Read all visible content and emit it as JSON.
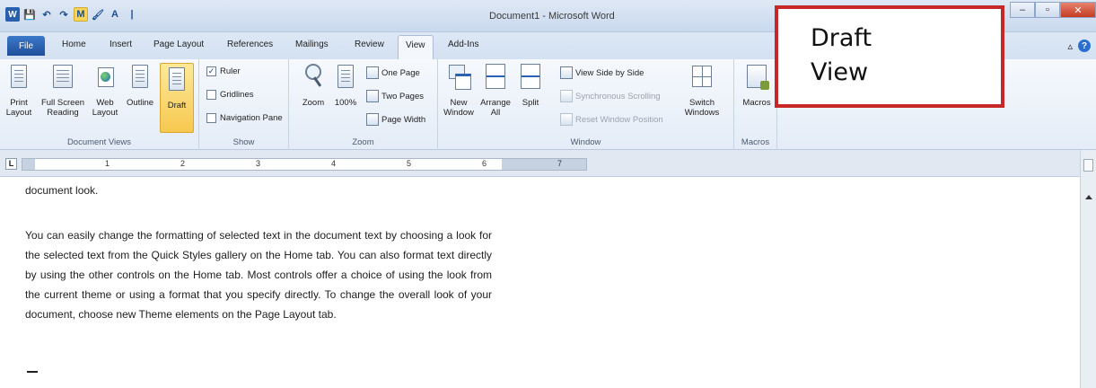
{
  "window": {
    "title": "Document1 - Microsoft Word",
    "controls": {
      "minimize": "–",
      "restore": "▫",
      "close": "✕"
    }
  },
  "quick_access": {
    "word_icon": "W",
    "save_icon": "💾",
    "undo_icon": "↶",
    "redo_icon": "↷",
    "highlight_icon": "M",
    "brush_icon": "🖌",
    "font_color_icon": "A",
    "more_icon": "|"
  },
  "tabs": [
    {
      "label": "File"
    },
    {
      "label": "Home"
    },
    {
      "label": "Insert"
    },
    {
      "label": "Page Layout"
    },
    {
      "label": "References"
    },
    {
      "label": "Mailings"
    },
    {
      "label": "Review"
    },
    {
      "label": "View"
    },
    {
      "label": "Add-Ins"
    }
  ],
  "active_tab": "View",
  "ribbon": {
    "document_views": {
      "label": "Document Views",
      "buttons": [
        "Print Layout",
        "Full Screen Reading",
        "Web Layout",
        "Outline",
        "Draft"
      ],
      "selected": "Draft"
    },
    "show": {
      "label": "Show",
      "checkboxes": [
        {
          "label": "Ruler",
          "checked": true
        },
        {
          "label": "Gridlines",
          "checked": false
        },
        {
          "label": "Navigation Pane",
          "checked": false
        }
      ]
    },
    "zoom": {
      "label": "Zoom",
      "buttons": [
        "Zoom",
        "100%"
      ],
      "small_buttons": [
        "One Page",
        "Two Pages",
        "Page Width"
      ]
    },
    "window": {
      "label": "Window",
      "buttons": [
        "New Window",
        "Arrange All",
        "Split"
      ],
      "small_buttons": [
        {
          "label": "View Side by Side",
          "enabled": true
        },
        {
          "label": "Synchronous Scrolling",
          "enabled": false
        },
        {
          "label": "Reset Window Position",
          "enabled": false
        }
      ],
      "switch": "Switch Windows"
    },
    "macros": {
      "label": "Macros",
      "button": "Macros"
    }
  },
  "ruler": {
    "tab_selector": "L",
    "numbers": [
      "1",
      "2",
      "3",
      "4",
      "5",
      "6",
      "7"
    ]
  },
  "document": {
    "paragraphs": [
      "document look.",
      "You can easily change the formatting of selected text in the document text by choosing a look for the selected text from the Quick Styles gallery on the Home tab. You can also format text directly by using the other controls on the Home tab. Most controls offer a choice of using the look from the current theme or using a format that you specify directly. To change the overall look of your document, choose new Theme elements on the Page Layout tab."
    ]
  },
  "annotation": {
    "line1": "Draft",
    "line2": "View",
    "border_color": "#c62828"
  }
}
